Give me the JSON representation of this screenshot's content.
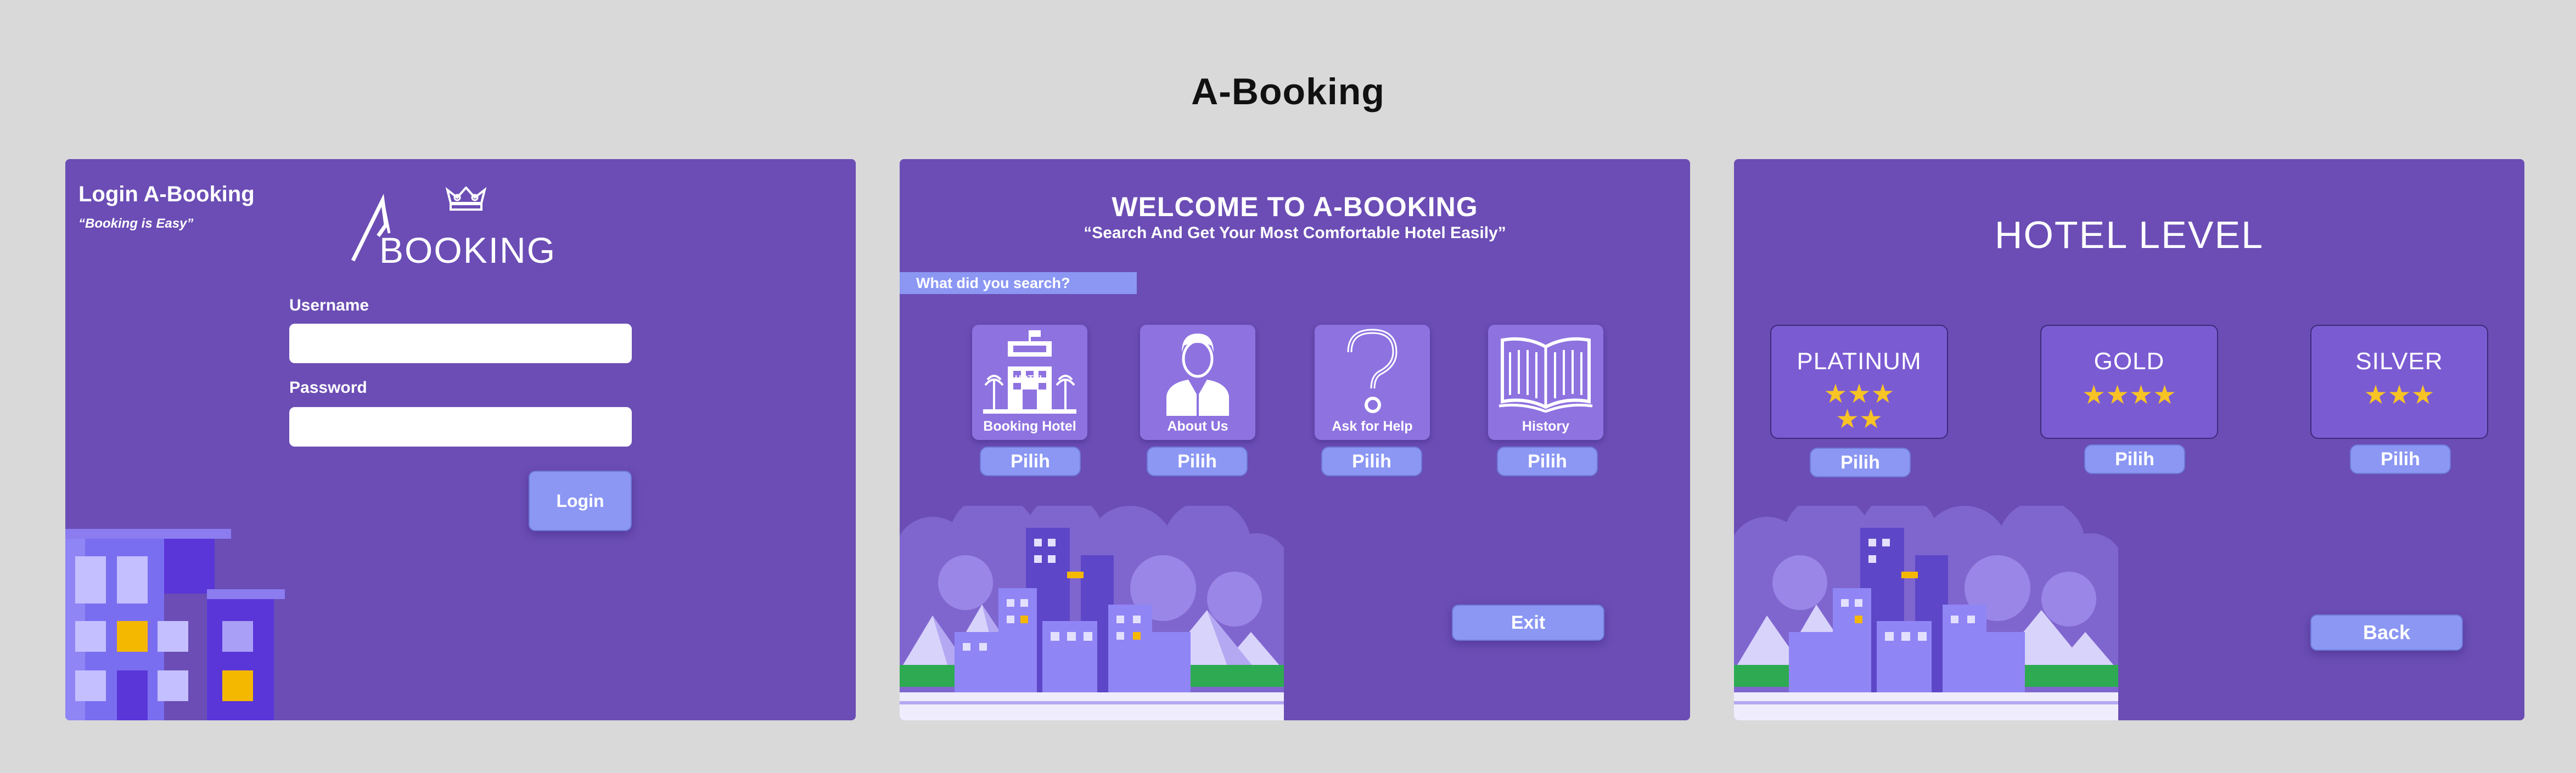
{
  "page_title": "A-Booking",
  "login": {
    "heading": "Login A-Booking",
    "tagline": "“Booking is Easy”",
    "logo_text": "BOOKING",
    "username_label": "Username",
    "username_value": "",
    "password_label": "Password",
    "password_value": "",
    "login_label": "Login"
  },
  "welcome": {
    "heading": "WELCOME TO A-BOOKING",
    "subtitle": "“Search And Get Your Most Comfortable Hotel Easily”",
    "prompt": "What did you search?",
    "hotel_sign": "HOTEL",
    "items": [
      {
        "label": "Booking Hotel",
        "button": "Pilih",
        "icon": "hotel-building-icon"
      },
      {
        "label": "About Us",
        "button": "Pilih",
        "icon": "person-icon"
      },
      {
        "label": "Ask for Help",
        "button": "Pilih",
        "icon": "question-mark-icon"
      },
      {
        "label": "History",
        "button": "Pilih",
        "icon": "open-book-icon"
      }
    ],
    "exit_label": "Exit"
  },
  "levels": {
    "heading": "HOTEL LEVEL",
    "items": [
      {
        "name": "PLATINUM",
        "stars_row1": "★★★",
        "stars_row2": "★★",
        "button": "Pilih"
      },
      {
        "name": "GOLD",
        "stars_row1": "★★★★",
        "stars_row2": "",
        "button": "Pilih"
      },
      {
        "name": "SILVER",
        "stars_row1": "★★★",
        "stars_row2": "",
        "button": "Pilih"
      }
    ],
    "back_label": "Back"
  },
  "colors": {
    "background": "#d9d9d9",
    "panel": "#6b4db5",
    "card": "#8e72e0",
    "button": "#8b97f3",
    "star": "#f7c325"
  }
}
